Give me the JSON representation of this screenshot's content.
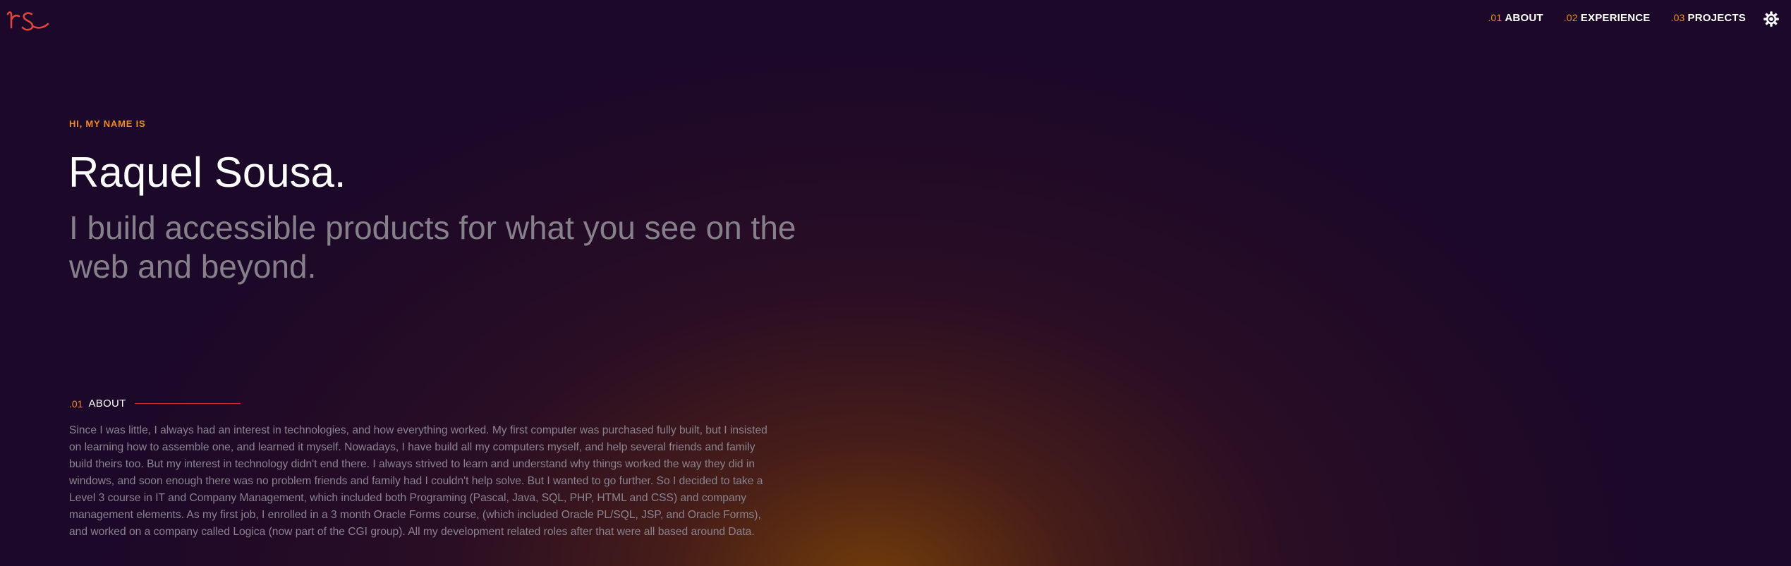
{
  "logo": {
    "icon": "rs-signature-logo",
    "text": "rs",
    "color": "#e0443a"
  },
  "nav": {
    "items": [
      {
        "num": ".01",
        "label": "ABOUT"
      },
      {
        "num": ".02",
        "label": "EXPERIENCE"
      },
      {
        "num": ".03",
        "label": "PROJECTS"
      }
    ],
    "theme_toggle_icon": "gear-sun-icon"
  },
  "hero": {
    "greeting": "HI, MY NAME IS",
    "name": "Raquel Sousa.",
    "tagline": "I build accessible products for what you see on the web and beyond."
  },
  "about": {
    "num": ".01",
    "title": "ABOUT",
    "text": "Since I was little, I always had an interest in technologies, and how everything worked. My first computer was purchased fully built, but I insisted on learning how to assemble one, and learned it myself. Nowadays, I have build all my computers myself, and help several friends and family build theirs too. But my interest in technology didn't end there. I always strived to learn and understand why things worked the way they did in windows, and soon enough there was no problem friends and family had I couldn't help solve. But I wanted to go further. So I decided to take a Level 3 course in IT and Company Management, which included both Programing (Pascal, Java, SQL, PHP, HTML and CSS) and company management elements. As my first job, I enrolled in a 3 month Oracle Forms course, (which included Oracle PL/SQL, JSP, and Oracle Forms), and worked on a company called Logica (now part of the CGI group). All my development related roles after that were all based around Data."
  },
  "colors": {
    "background": "#1c0829",
    "accent": "#f08a24",
    "divider": "#d8262b",
    "muted_text": "#86808a"
  }
}
